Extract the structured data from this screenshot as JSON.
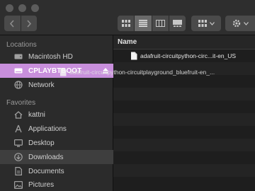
{
  "toolbar": {
    "back_icon": "chevron-left-icon",
    "forward_icon": "chevron-right-icon",
    "view_modes": [
      "icon-view",
      "list-view",
      "column-view",
      "gallery-view"
    ],
    "active_view": "list-view"
  },
  "sidebar": {
    "locations_label": "Locations",
    "favorites_label": "Favorites",
    "locations": [
      {
        "label": "Macintosh HD",
        "icon": "hard-drive-icon"
      },
      {
        "label": "CPLAYBTBOOT",
        "icon": "external-drive-icon",
        "state": "drop-target"
      },
      {
        "label": "Network",
        "icon": "globe-icon"
      }
    ],
    "favorites": [
      {
        "label": "kattni",
        "icon": "home-icon"
      },
      {
        "label": "Applications",
        "icon": "applications-icon"
      },
      {
        "label": "Desktop",
        "icon": "desktop-icon"
      },
      {
        "label": "Downloads",
        "icon": "downloads-icon",
        "state": "selected"
      },
      {
        "label": "Documents",
        "icon": "documents-icon"
      },
      {
        "label": "Pictures",
        "icon": "pictures-icon"
      }
    ]
  },
  "main": {
    "column_name": "Name",
    "files": [
      {
        "name": "adafruit-circuitpython-circ...it-en_US"
      }
    ]
  },
  "drag": {
    "filename": "adafruit-circuitpython-circuitplayground_bluefruit-en_..."
  },
  "colors": {
    "drop_highlight": "#c88fdc",
    "sidebar_bg": "#2b2b2b",
    "window_bg": "#1e1e1e"
  }
}
